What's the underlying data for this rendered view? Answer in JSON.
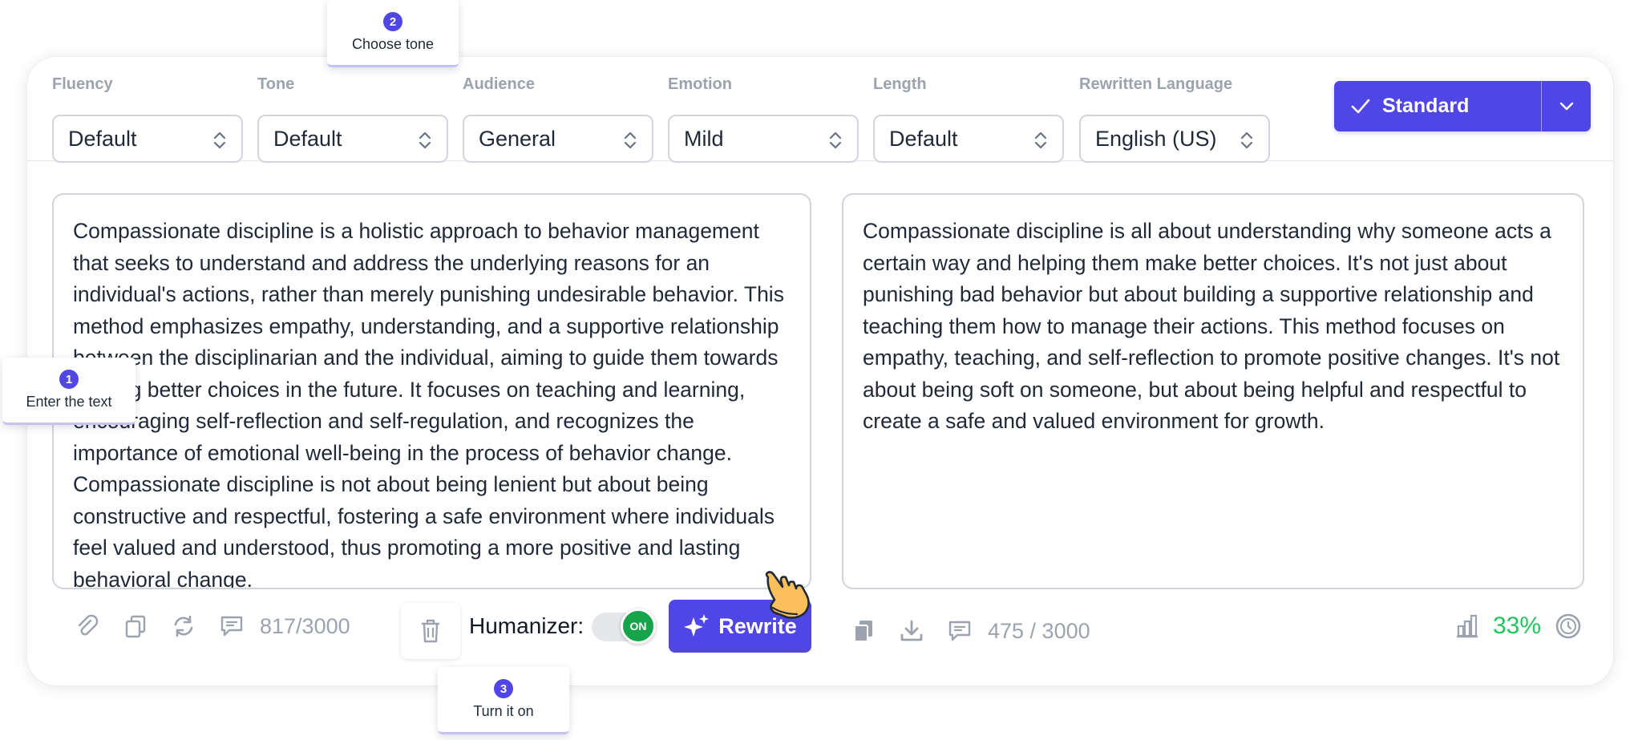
{
  "settings": {
    "fields": [
      {
        "label": "Fluency",
        "value": "Default"
      },
      {
        "label": "Tone",
        "value": "Default"
      },
      {
        "label": "Audience",
        "value": "General"
      },
      {
        "label": "Emotion",
        "value": "Mild"
      },
      {
        "label": "Length",
        "value": "Default"
      },
      {
        "label": "Rewritten Language",
        "value": "English (US)"
      }
    ],
    "mode_button": "Standard"
  },
  "input": {
    "text": "Compassionate discipline is a holistic approach to behavior management that seeks to understand and address the underlying reasons for an individual's actions, rather than merely punishing undesirable behavior. This method emphasizes empathy, understanding, and a supportive relationship between the disciplinarian and the individual, aiming to guide them towards making better choices in the future. It focuses on teaching and learning, encouraging self-reflection and self-regulation, and recognizes the importance of emotional well-being in the process of behavior change. Compassionate discipline is not about being lenient but about being constructive and respectful, fostering a safe environment where individuals feel valued and understood, thus promoting a more positive and lasting behavioral change.",
    "counter": "817/3000"
  },
  "output": {
    "text": "Compassionate discipline is all about understanding why someone acts a certain way and helping them make better choices. It's not just about punishing bad behavior but about building a supportive relationship and teaching them how to manage their actions. This method focuses on empathy, teaching, and self-reflection to promote positive changes. It's not about being soft on someone, but about being helpful and respectful to create a safe and valued environment for growth.",
    "counter": "475 / 3000",
    "score": "33%"
  },
  "controls": {
    "humanizer_label": "Humanizer:",
    "toggle_state": "ON",
    "rewrite_label": "Rewrite"
  },
  "tips": [
    {
      "number": "1",
      "text": "Enter the text"
    },
    {
      "number": "2",
      "text": "Choose tone"
    },
    {
      "number": "3",
      "text": "Turn it on"
    }
  ],
  "colors": {
    "accent": "#4f46e5",
    "success": "#22c55e",
    "toggle_on": "#16a34a",
    "muted": "#9ca3af"
  },
  "icons": [
    "attach-icon",
    "copy-icon",
    "refresh-icon",
    "comment-icon",
    "trash-icon",
    "sparkle-icon",
    "hand-pointer-icon",
    "paste-icon",
    "download-icon",
    "bar-chart-icon",
    "history-icon",
    "check-icon",
    "chevron-down-icon"
  ]
}
